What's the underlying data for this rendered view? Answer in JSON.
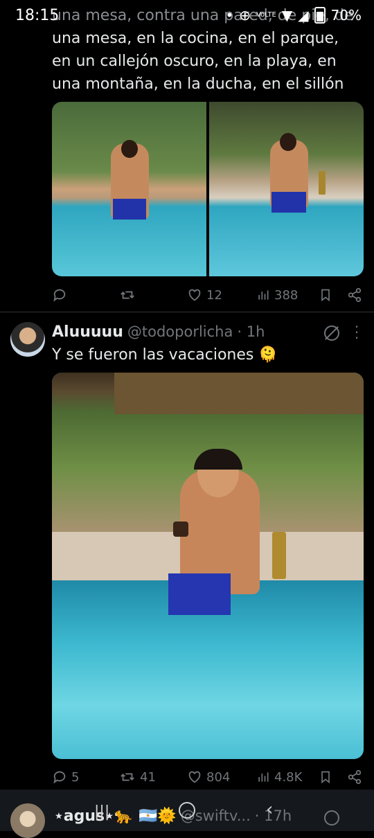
{
  "status": {
    "time": "18:15",
    "battery": "70%",
    "network": "VoLTE"
  },
  "tweet1": {
    "text_line1": "una mesa, contra una pared, de pie, de",
    "text_line2": "una mesa, en la cocina, en el parque,",
    "text_line3": "en un callejón oscuro, en la playa, en",
    "text_line4": "una montaña, en la ducha, en el sillón",
    "retweets": "",
    "likes": "12",
    "views": "388"
  },
  "tweet2": {
    "display_name": "Aluuuuu",
    "handle": "@todoporlicha",
    "time": "· 1h",
    "text": "Y se fueron las vacaciones 🫠",
    "replies": "5",
    "retweets": "41",
    "likes": "804",
    "views": "4.8K"
  },
  "tweet3": {
    "display_name": "⋆agus⋆🐆 🇦🇷🌞",
    "handle": "@swiftv...",
    "time": "· 17h"
  },
  "colors": {
    "background": "#000000",
    "text": "#e7e9ea",
    "muted": "#71767b",
    "divider": "#2f3336",
    "pool": "#3fb6c9"
  }
}
